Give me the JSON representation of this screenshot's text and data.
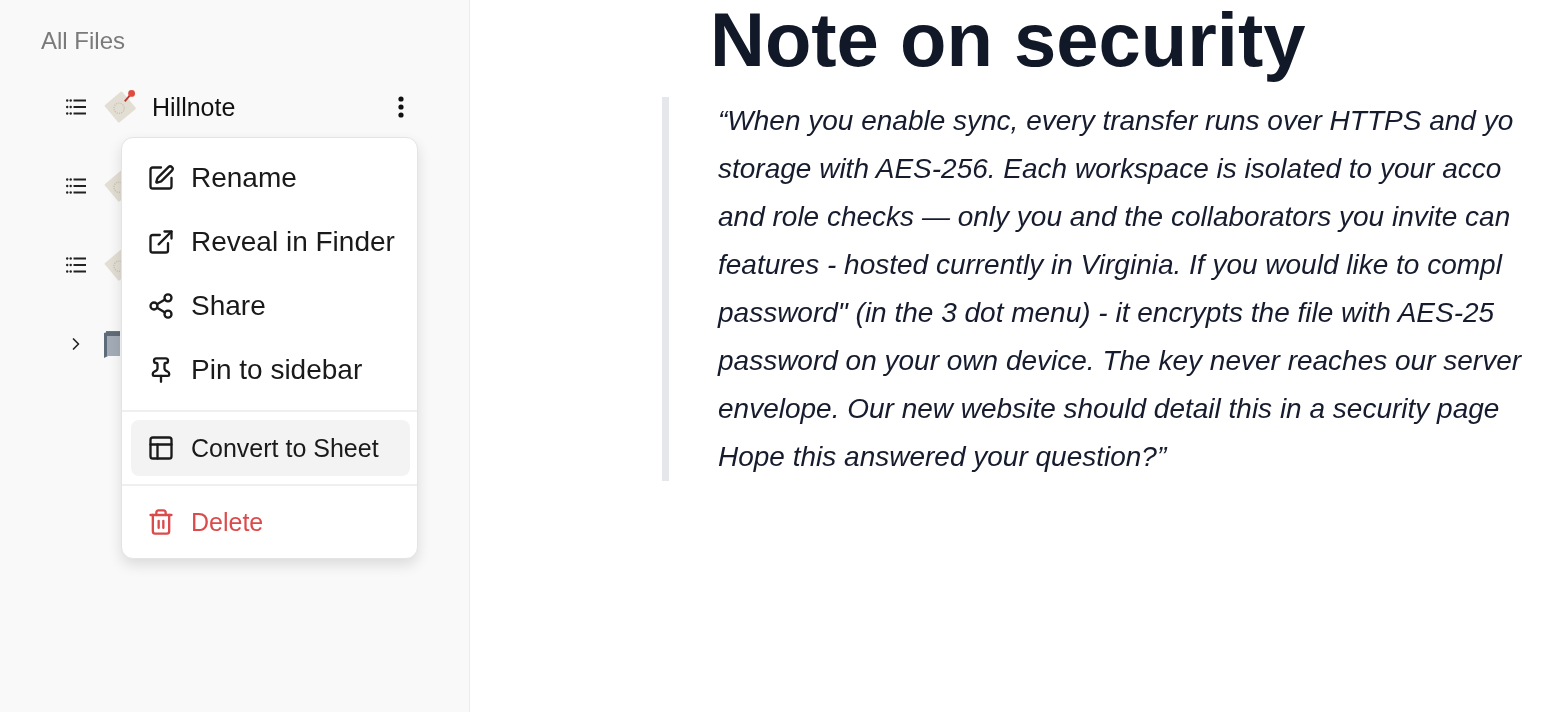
{
  "sidebar": {
    "title": "All Files",
    "tree": [
      {
        "kind": "document",
        "name": "Hillnote",
        "menu_open": true
      },
      {
        "kind": "document",
        "menu_open": false
      },
      {
        "kind": "document",
        "menu_open": false
      },
      {
        "kind": "folder",
        "expanded": false,
        "menu_open": false
      }
    ]
  },
  "context_menu": {
    "sections": [
      {
        "items": [
          {
            "label": "Rename",
            "kind": "normal",
            "highlighted": false
          },
          {
            "label": "Reveal in Finder",
            "kind": "normal",
            "highlighted": false
          },
          {
            "label": "Share",
            "kind": "normal",
            "highlighted": false
          },
          {
            "label": "Pin to sidebar",
            "kind": "normal",
            "highlighted": false
          }
        ]
      },
      {
        "items": [
          {
            "label": "Convert to Sheet",
            "kind": "normal",
            "highlighted": true
          }
        ]
      },
      {
        "items": [
          {
            "label": "Delete",
            "kind": "danger",
            "highlighted": false
          }
        ]
      }
    ]
  },
  "document": {
    "title": "Note on security",
    "quote": {
      "lines": [
        "“When you enable sync, every transfer runs over HTTPS and yo",
        "storage with AES-256. Each workspace is isolated to your acco",
        "and role checks — only you and the collaborators you invite can",
        "features - hosted currently in Virginia. If you would like to compl",
        "password\" (in the 3 dot menu) - it encrypts the file with AES-25",
        "password on your own device. The key never reaches our server",
        "envelope. Our new website should detail this in a security page",
        "Hope this answered your question?”"
      ]
    }
  }
}
